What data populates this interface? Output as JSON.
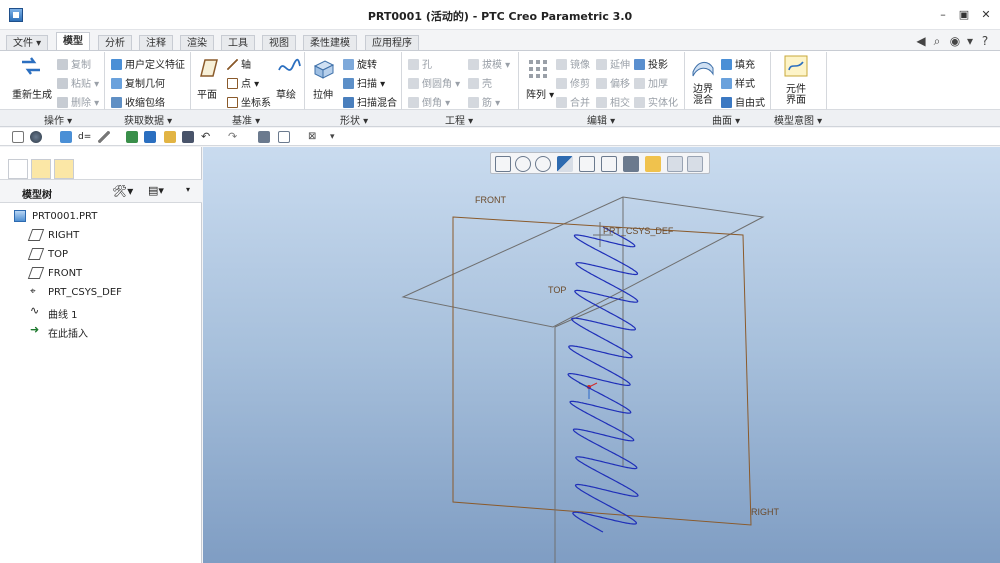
{
  "window": {
    "title": "PRT0001 (活动的) - PTC Creo Parametric 3.0"
  },
  "tabs": [
    {
      "label": "文件"
    },
    {
      "label": "模型"
    },
    {
      "label": "分析"
    },
    {
      "label": "注释"
    },
    {
      "label": "渲染"
    },
    {
      "label": "工具"
    },
    {
      "label": "视图"
    },
    {
      "label": "柔性建模"
    },
    {
      "label": "应用程序"
    }
  ],
  "ribbon": {
    "regenerate": "重新生成",
    "copy": "复制",
    "paste": "粘贴",
    "delete": "删除",
    "user_feature": "用户定义特征",
    "copy_geometry": "复制几何",
    "shrinkwrap": "收缩包络",
    "plane": "平面",
    "axis": "轴",
    "point": "点",
    "csys": "坐标系",
    "sketch": "草绘",
    "extrude": "拉伸",
    "revolve": "旋转",
    "sweep": "扫描",
    "swept_blend": "扫描混合",
    "hole": "孔",
    "round": "倒圆角",
    "chamfer": "倒角",
    "draft": "拔模",
    "shell": "壳",
    "rib": "筋",
    "pattern": "阵列",
    "mirror": "镜像",
    "extend": "延伸",
    "project": "投影",
    "trim": "修剪",
    "offset": "偏移",
    "thicken": "加厚",
    "merge": "合并",
    "intersect": "相交",
    "solidify": "实体化",
    "boundary_blend_1": "边界",
    "boundary_blend_2": "混合",
    "fill": "填充",
    "style": "样式",
    "freestyle": "自由式",
    "component_interface_1": "元件",
    "component_interface_2": "界面"
  },
  "groups": [
    {
      "label": "操作"
    },
    {
      "label": "获取数据"
    },
    {
      "label": "基准"
    },
    {
      "label": "形状"
    },
    {
      "label": "工程"
    },
    {
      "label": "编辑"
    },
    {
      "label": "曲面"
    },
    {
      "label": "模型意图"
    }
  ],
  "model_tree": {
    "title": "模型树",
    "items": [
      {
        "label": "PRT0001.PRT"
      },
      {
        "label": "RIGHT"
      },
      {
        "label": "TOP"
      },
      {
        "label": "FRONT"
      },
      {
        "label": "PRT_CSYS_DEF"
      },
      {
        "label": "曲线 1"
      },
      {
        "label": "在此插入"
      }
    ]
  },
  "graphics": {
    "labels": {
      "front": "FRONT",
      "top": "TOP",
      "right": "RIGHT",
      "csys": "PRT_CSYS_DEF"
    }
  },
  "colors": {
    "curve": "#1f2fb8",
    "datum_plane": "#8a5a2b",
    "ribbon_accent": "#2b6fc0"
  }
}
